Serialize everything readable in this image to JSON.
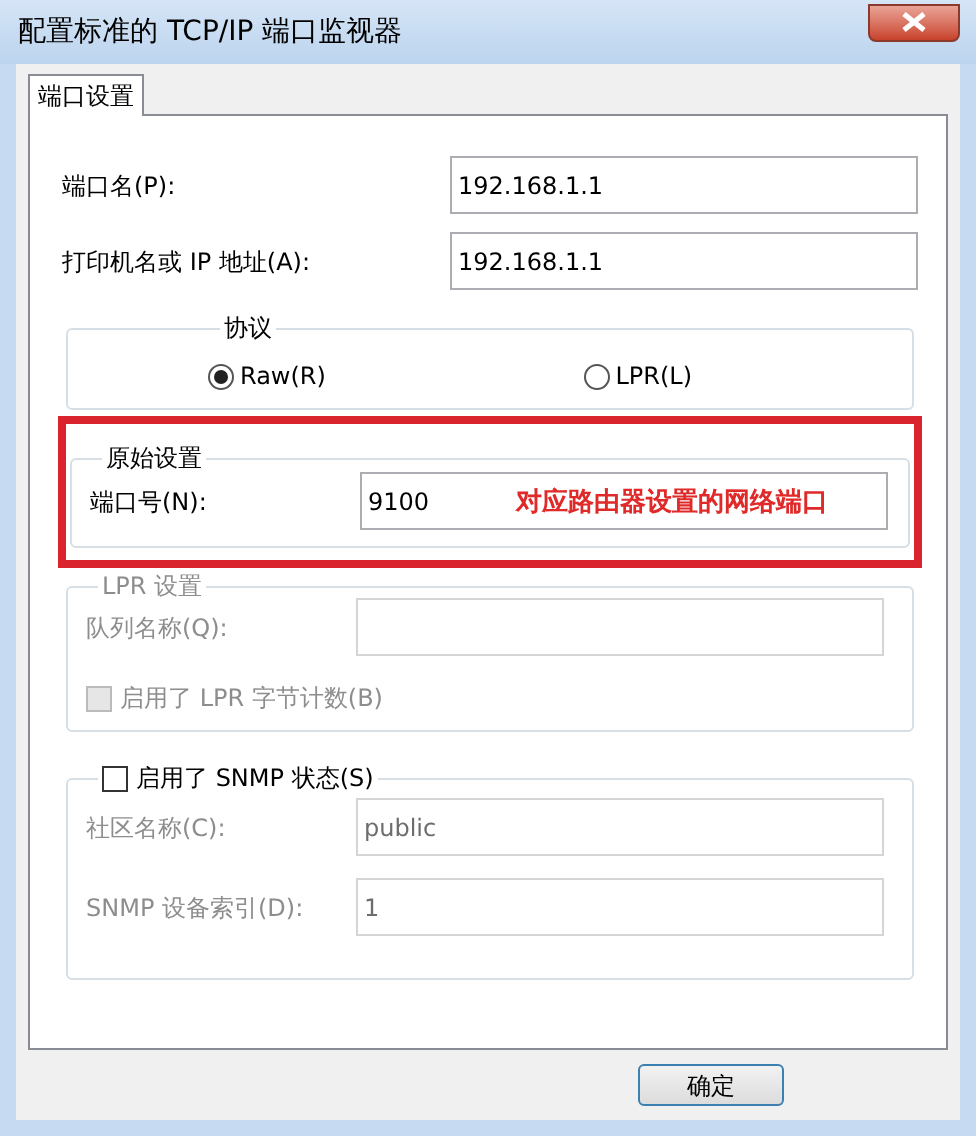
{
  "window": {
    "title": "配置标准的 TCP/IP 端口监视器"
  },
  "tabs": [
    {
      "label": "端口设置",
      "selected": true
    }
  ],
  "fields": [
    {
      "label": "端口名(P):",
      "value": "192.168.1.1"
    },
    {
      "label": "打印机名或 IP 地址(A):",
      "value": "192.168.1.1"
    }
  ],
  "protocol": {
    "title": "协议",
    "options": [
      {
        "label": "Raw(R)",
        "selected": true
      },
      {
        "label": "LPR(L)",
        "selected": false
      }
    ]
  },
  "raw_settings": {
    "title": "原始设置",
    "port": {
      "label": "端口号(N):",
      "value": "9100"
    },
    "annotation": "对应路由器设置的网络端口"
  },
  "lpr_settings": {
    "title": "LPR 设置",
    "disabled": true,
    "queue": {
      "label": "队列名称(Q):"
    },
    "byte_count": {
      "label": "启用了 LPR 字节计数(B)",
      "checked": false
    }
  },
  "snmp": {
    "label": "启用了 SNMP 状态(S)",
    "checked": false,
    "community": {
      "label": "社区名称(C):",
      "value": "public"
    },
    "device_index": {
      "label": "SNMP 设备索引(D):",
      "value": "1"
    }
  },
  "buttons": [
    "确定"
  ]
}
